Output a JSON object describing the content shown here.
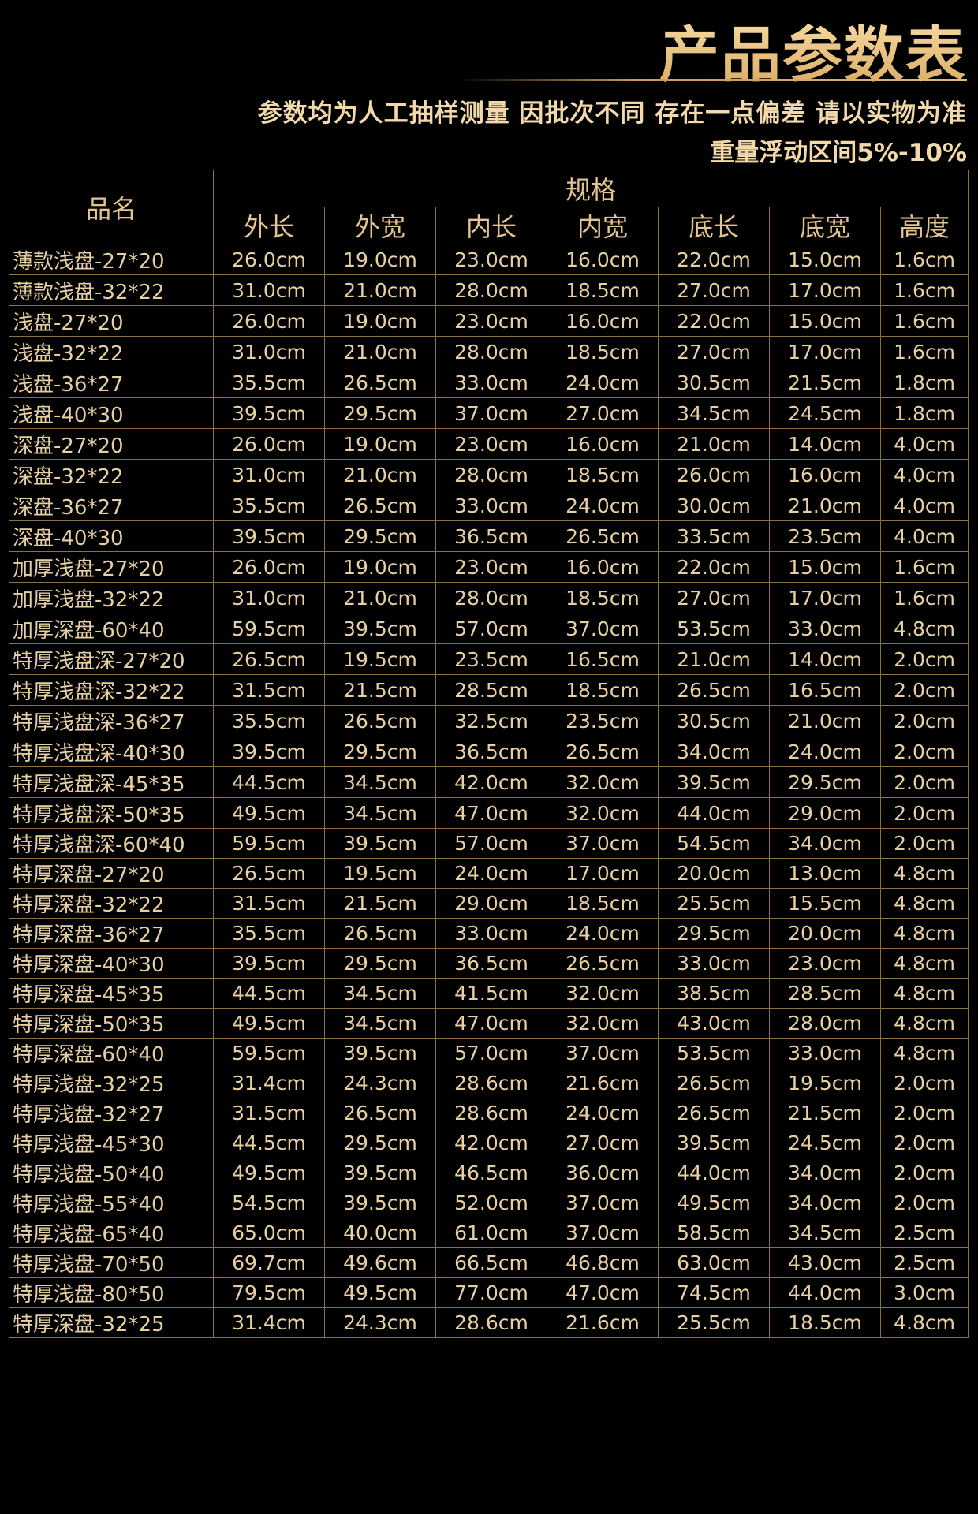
{
  "header": {
    "title": "产品参数表",
    "subtitle": "参数均为人工抽样测量 因批次不同 存在一点偏差 请以实物为准",
    "range": "重量浮动区间5%-10%"
  },
  "table": {
    "name_header": "品名",
    "spec_header": "规格",
    "columns": [
      "外长",
      "外宽",
      "内长",
      "内宽",
      "底长",
      "底宽",
      "高度"
    ],
    "rows": [
      {
        "name": "薄款浅盘-27*20",
        "values": [
          "26.0cm",
          "19.0cm",
          "23.0cm",
          "16.0cm",
          "22.0cm",
          "15.0cm",
          "1.6cm"
        ]
      },
      {
        "name": "薄款浅盘-32*22",
        "values": [
          "31.0cm",
          "21.0cm",
          "28.0cm",
          "18.5cm",
          "27.0cm",
          "17.0cm",
          "1.6cm"
        ]
      },
      {
        "name": "浅盘-27*20",
        "values": [
          "26.0cm",
          "19.0cm",
          "23.0cm",
          "16.0cm",
          "22.0cm",
          "15.0cm",
          "1.6cm"
        ]
      },
      {
        "name": "浅盘-32*22",
        "values": [
          "31.0cm",
          "21.0cm",
          "28.0cm",
          "18.5cm",
          "27.0cm",
          "17.0cm",
          "1.6cm"
        ]
      },
      {
        "name": "浅盘-36*27",
        "values": [
          "35.5cm",
          "26.5cm",
          "33.0cm",
          "24.0cm",
          "30.5cm",
          "21.5cm",
          "1.8cm"
        ]
      },
      {
        "name": "浅盘-40*30",
        "values": [
          "39.5cm",
          "29.5cm",
          "37.0cm",
          "27.0cm",
          "34.5cm",
          "24.5cm",
          "1.8cm"
        ]
      },
      {
        "name": "深盘-27*20",
        "values": [
          "26.0cm",
          "19.0cm",
          "23.0cm",
          "16.0cm",
          "21.0cm",
          "14.0cm",
          "4.0cm"
        ]
      },
      {
        "name": "深盘-32*22",
        "values": [
          "31.0cm",
          "21.0cm",
          "28.0cm",
          "18.5cm",
          "26.0cm",
          "16.0cm",
          "4.0cm"
        ]
      },
      {
        "name": "深盘-36*27",
        "values": [
          "35.5cm",
          "26.5cm",
          "33.0cm",
          "24.0cm",
          "30.0cm",
          "21.0cm",
          "4.0cm"
        ]
      },
      {
        "name": "深盘-40*30",
        "values": [
          "39.5cm",
          "29.5cm",
          "36.5cm",
          "26.5cm",
          "33.5cm",
          "23.5cm",
          "4.0cm"
        ]
      },
      {
        "name": "加厚浅盘-27*20",
        "values": [
          "26.0cm",
          "19.0cm",
          "23.0cm",
          "16.0cm",
          "22.0cm",
          "15.0cm",
          "1.6cm"
        ]
      },
      {
        "name": "加厚浅盘-32*22",
        "values": [
          "31.0cm",
          "21.0cm",
          "28.0cm",
          "18.5cm",
          "27.0cm",
          "17.0cm",
          "1.6cm"
        ]
      },
      {
        "name": "加厚深盘-60*40",
        "values": [
          "59.5cm",
          "39.5cm",
          "57.0cm",
          "37.0cm",
          "53.5cm",
          "33.0cm",
          "4.8cm"
        ]
      },
      {
        "name": "特厚浅盘深-27*20",
        "values": [
          "26.5cm",
          "19.5cm",
          "23.5cm",
          "16.5cm",
          "21.0cm",
          "14.0cm",
          "2.0cm"
        ]
      },
      {
        "name": "特厚浅盘深-32*22",
        "values": [
          "31.5cm",
          "21.5cm",
          "28.5cm",
          "18.5cm",
          "26.5cm",
          "16.5cm",
          "2.0cm"
        ]
      },
      {
        "name": "特厚浅盘深-36*27",
        "values": [
          "35.5cm",
          "26.5cm",
          "32.5cm",
          "23.5cm",
          "30.5cm",
          "21.0cm",
          "2.0cm"
        ]
      },
      {
        "name": "特厚浅盘深-40*30",
        "values": [
          "39.5cm",
          "29.5cm",
          "36.5cm",
          "26.5cm",
          "34.0cm",
          "24.0cm",
          "2.0cm"
        ]
      },
      {
        "name": "特厚浅盘深-45*35",
        "values": [
          "44.5cm",
          "34.5cm",
          "42.0cm",
          "32.0cm",
          "39.5cm",
          "29.5cm",
          "2.0cm"
        ]
      },
      {
        "name": "特厚浅盘深-50*35",
        "values": [
          "49.5cm",
          "34.5cm",
          "47.0cm",
          "32.0cm",
          "44.0cm",
          "29.0cm",
          "2.0cm"
        ]
      },
      {
        "name": "特厚浅盘深-60*40",
        "values": [
          "59.5cm",
          "39.5cm",
          "57.0cm",
          "37.0cm",
          "54.5cm",
          "34.0cm",
          "2.0cm"
        ]
      },
      {
        "name": "特厚深盘-27*20",
        "values": [
          "26.5cm",
          "19.5cm",
          "24.0cm",
          "17.0cm",
          "20.0cm",
          "13.0cm",
          "4.8cm"
        ]
      },
      {
        "name": "特厚深盘-32*22",
        "values": [
          "31.5cm",
          "21.5cm",
          "29.0cm",
          "18.5cm",
          "25.5cm",
          "15.5cm",
          "4.8cm"
        ]
      },
      {
        "name": "特厚深盘-36*27",
        "values": [
          "35.5cm",
          "26.5cm",
          "33.0cm",
          "24.0cm",
          "29.5cm",
          "20.0cm",
          "4.8cm"
        ]
      },
      {
        "name": "特厚深盘-40*30",
        "values": [
          "39.5cm",
          "29.5cm",
          "36.5cm",
          "26.5cm",
          "33.0cm",
          "23.0cm",
          "4.8cm"
        ]
      },
      {
        "name": "特厚深盘-45*35",
        "values": [
          "44.5cm",
          "34.5cm",
          "41.5cm",
          "32.0cm",
          "38.5cm",
          "28.5cm",
          "4.8cm"
        ]
      },
      {
        "name": "特厚深盘-50*35",
        "values": [
          "49.5cm",
          "34.5cm",
          "47.0cm",
          "32.0cm",
          "43.0cm",
          "28.0cm",
          "4.8cm"
        ]
      },
      {
        "name": "特厚深盘-60*40",
        "values": [
          "59.5cm",
          "39.5cm",
          "57.0cm",
          "37.0cm",
          "53.5cm",
          "33.0cm",
          "4.8cm"
        ]
      },
      {
        "name": "特厚浅盘-32*25",
        "values": [
          "31.4cm",
          "24.3cm",
          "28.6cm",
          "21.6cm",
          "26.5cm",
          "19.5cm",
          "2.0cm"
        ]
      },
      {
        "name": "特厚浅盘-32*27",
        "values": [
          "31.5cm",
          "26.5cm",
          "28.6cm",
          "24.0cm",
          "26.5cm",
          "21.5cm",
          "2.0cm"
        ]
      },
      {
        "name": "特厚浅盘-45*30",
        "values": [
          "44.5cm",
          "29.5cm",
          "42.0cm",
          "27.0cm",
          "39.5cm",
          "24.5cm",
          "2.0cm"
        ]
      },
      {
        "name": "特厚浅盘-50*40",
        "values": [
          "49.5cm",
          "39.5cm",
          "46.5cm",
          "36.0cm",
          "44.0cm",
          "34.0cm",
          "2.0cm"
        ]
      },
      {
        "name": "特厚浅盘-55*40",
        "values": [
          "54.5cm",
          "39.5cm",
          "52.0cm",
          "37.0cm",
          "49.5cm",
          "34.0cm",
          "2.0cm"
        ]
      },
      {
        "name": "特厚浅盘-65*40",
        "values": [
          "65.0cm",
          "40.0cm",
          "61.0cm",
          "37.0cm",
          "58.5cm",
          "34.5cm",
          "2.5cm"
        ]
      },
      {
        "name": "特厚浅盘-70*50",
        "values": [
          "69.7cm",
          "49.6cm",
          "66.5cm",
          "46.8cm",
          "63.0cm",
          "43.0cm",
          "2.5cm"
        ]
      },
      {
        "name": "特厚浅盘-80*50",
        "values": [
          "79.5cm",
          "49.5cm",
          "77.0cm",
          "47.0cm",
          "74.5cm",
          "44.0cm",
          "3.0cm"
        ]
      },
      {
        "name": "特厚深盘-32*25",
        "values": [
          "31.4cm",
          "24.3cm",
          "28.6cm",
          "21.6cm",
          "25.5cm",
          "18.5cm",
          "4.8cm"
        ]
      }
    ]
  }
}
